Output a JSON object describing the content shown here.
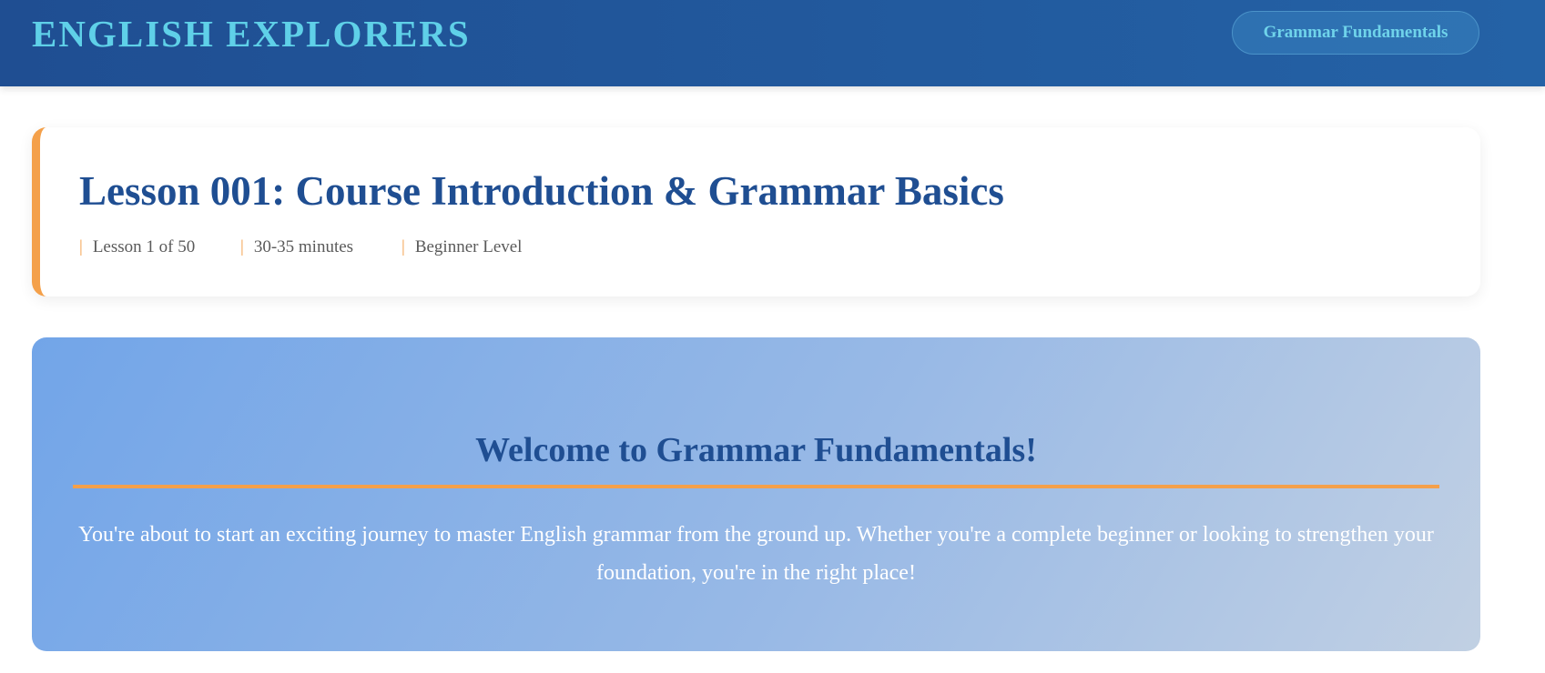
{
  "header": {
    "brand": "ENGLISH EXPLORERS",
    "course_button": "Grammar Fundamentals"
  },
  "lesson": {
    "title": "Lesson 001: Course Introduction & Grammar Basics",
    "meta": [
      "Lesson 1 of 50",
      "30-35 minutes",
      "Beginner Level"
    ],
    "separator": "|"
  },
  "welcome": {
    "title": "Welcome to Grammar Fundamentals!",
    "text": "You're about to start an exciting journey to master English grammar from the ground up. Whether you're a complete beginner or looking to strengthen your foundation, you're in the right place!"
  },
  "colors": {
    "header_bg": "#1f4e92",
    "brand_text": "#5fd0e8",
    "accent_orange": "#f4a04a",
    "title_blue": "#1f4e92"
  }
}
